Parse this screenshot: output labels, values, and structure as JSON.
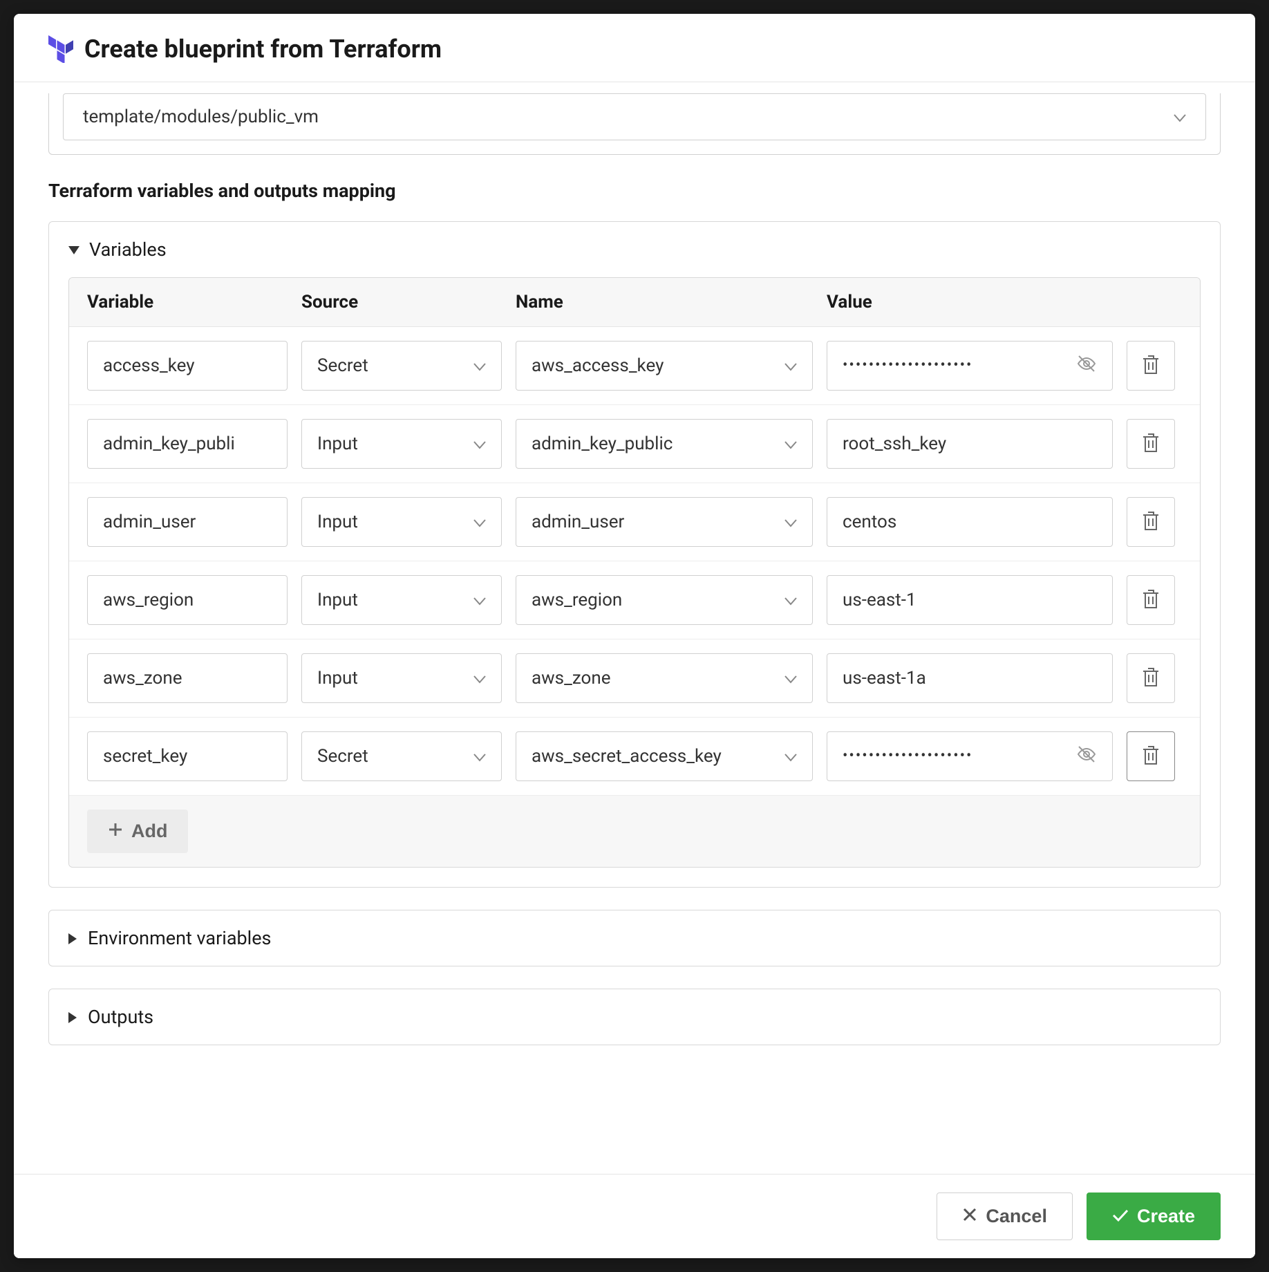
{
  "modal": {
    "title": "Create blueprint from Terraform",
    "module_path": "template/modules/public_vm",
    "mapping_title": "Terraform variables and outputs mapping",
    "variables_label": "Variables",
    "env_vars_label": "Environment variables",
    "outputs_label": "Outputs",
    "add_label": "Add",
    "cancel_label": "Cancel",
    "create_label": "Create"
  },
  "table": {
    "headers": {
      "variable": "Variable",
      "source": "Source",
      "name": "Name",
      "value": "Value"
    },
    "rows": [
      {
        "variable": "access_key",
        "source": "Secret",
        "name": "aws_access_key",
        "value": "••••••••••••••••••••",
        "secret": true
      },
      {
        "variable": "admin_key_publi",
        "source": "Input",
        "name": "admin_key_public",
        "value": "root_ssh_key",
        "secret": false
      },
      {
        "variable": "admin_user",
        "source": "Input",
        "name": "admin_user",
        "value": "centos",
        "secret": false
      },
      {
        "variable": "aws_region",
        "source": "Input",
        "name": "aws_region",
        "value": "us-east-1",
        "secret": false
      },
      {
        "variable": "aws_zone",
        "source": "Input",
        "name": "aws_zone",
        "value": "us-east-1a",
        "secret": false
      },
      {
        "variable": "secret_key",
        "source": "Secret",
        "name": "aws_secret_access_key",
        "value": "••••••••••••••••••••",
        "secret": true
      }
    ]
  }
}
